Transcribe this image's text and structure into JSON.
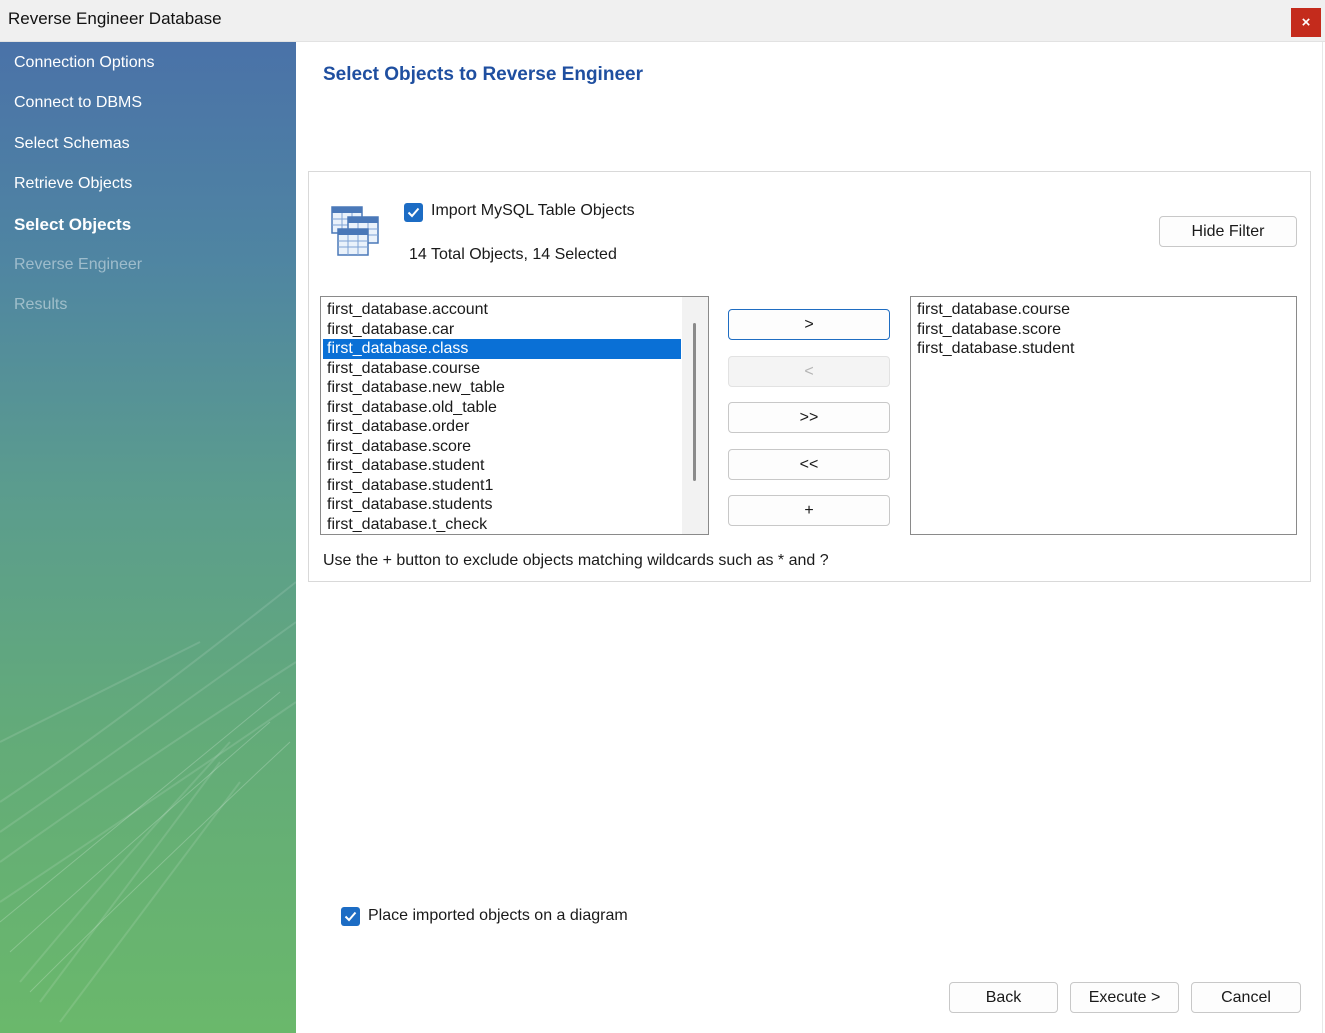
{
  "window": {
    "title": "Reverse Engineer Database",
    "close_label": "×"
  },
  "sidebar": {
    "steps": [
      {
        "label": "Connection Options",
        "state": "done"
      },
      {
        "label": "Connect to DBMS",
        "state": "done"
      },
      {
        "label": "Select Schemas",
        "state": "done"
      },
      {
        "label": "Retrieve Objects",
        "state": "done"
      },
      {
        "label": "Select Objects",
        "state": "active"
      },
      {
        "label": "Reverse Engineer",
        "state": "pending"
      },
      {
        "label": "Results",
        "state": "pending"
      }
    ]
  },
  "main": {
    "heading": "Select Objects to Reverse Engineer",
    "import_checkbox": {
      "label": "Import MySQL Table Objects",
      "checked": true
    },
    "count_text": "14 Total Objects, 14 Selected",
    "hide_filter_label": "Hide Filter",
    "available_list": [
      "first_database.account",
      "first_database.car",
      "first_database.class",
      "first_database.course",
      "first_database.new_table",
      "first_database.old_table",
      "first_database.order",
      "first_database.score",
      "first_database.student",
      "first_database.student1",
      "first_database.students",
      "first_database.t_check"
    ],
    "available_selected": "first_database.class",
    "excluded_list": [
      "first_database.course",
      "first_database.score",
      "first_database.student"
    ],
    "move_buttons": {
      "add": ">",
      "remove": "<",
      "add_all": ">>",
      "remove_all": "<<",
      "add_wildcard": "+"
    },
    "hint": "Use the + button to exclude objects matching wildcards such as * and ?",
    "diagram_checkbox": {
      "label": "Place imported objects on a diagram",
      "checked": true
    }
  },
  "footer": {
    "back_label": "Back",
    "execute_label": "Execute >",
    "cancel_label": "Cancel"
  },
  "colors": {
    "accent": "#1c6cc4",
    "heading": "#1f4fa0",
    "selection": "#0a70d6",
    "close": "#c42b1c"
  },
  "icons": [
    "close-icon",
    "tables-icon",
    "check-icon"
  ]
}
